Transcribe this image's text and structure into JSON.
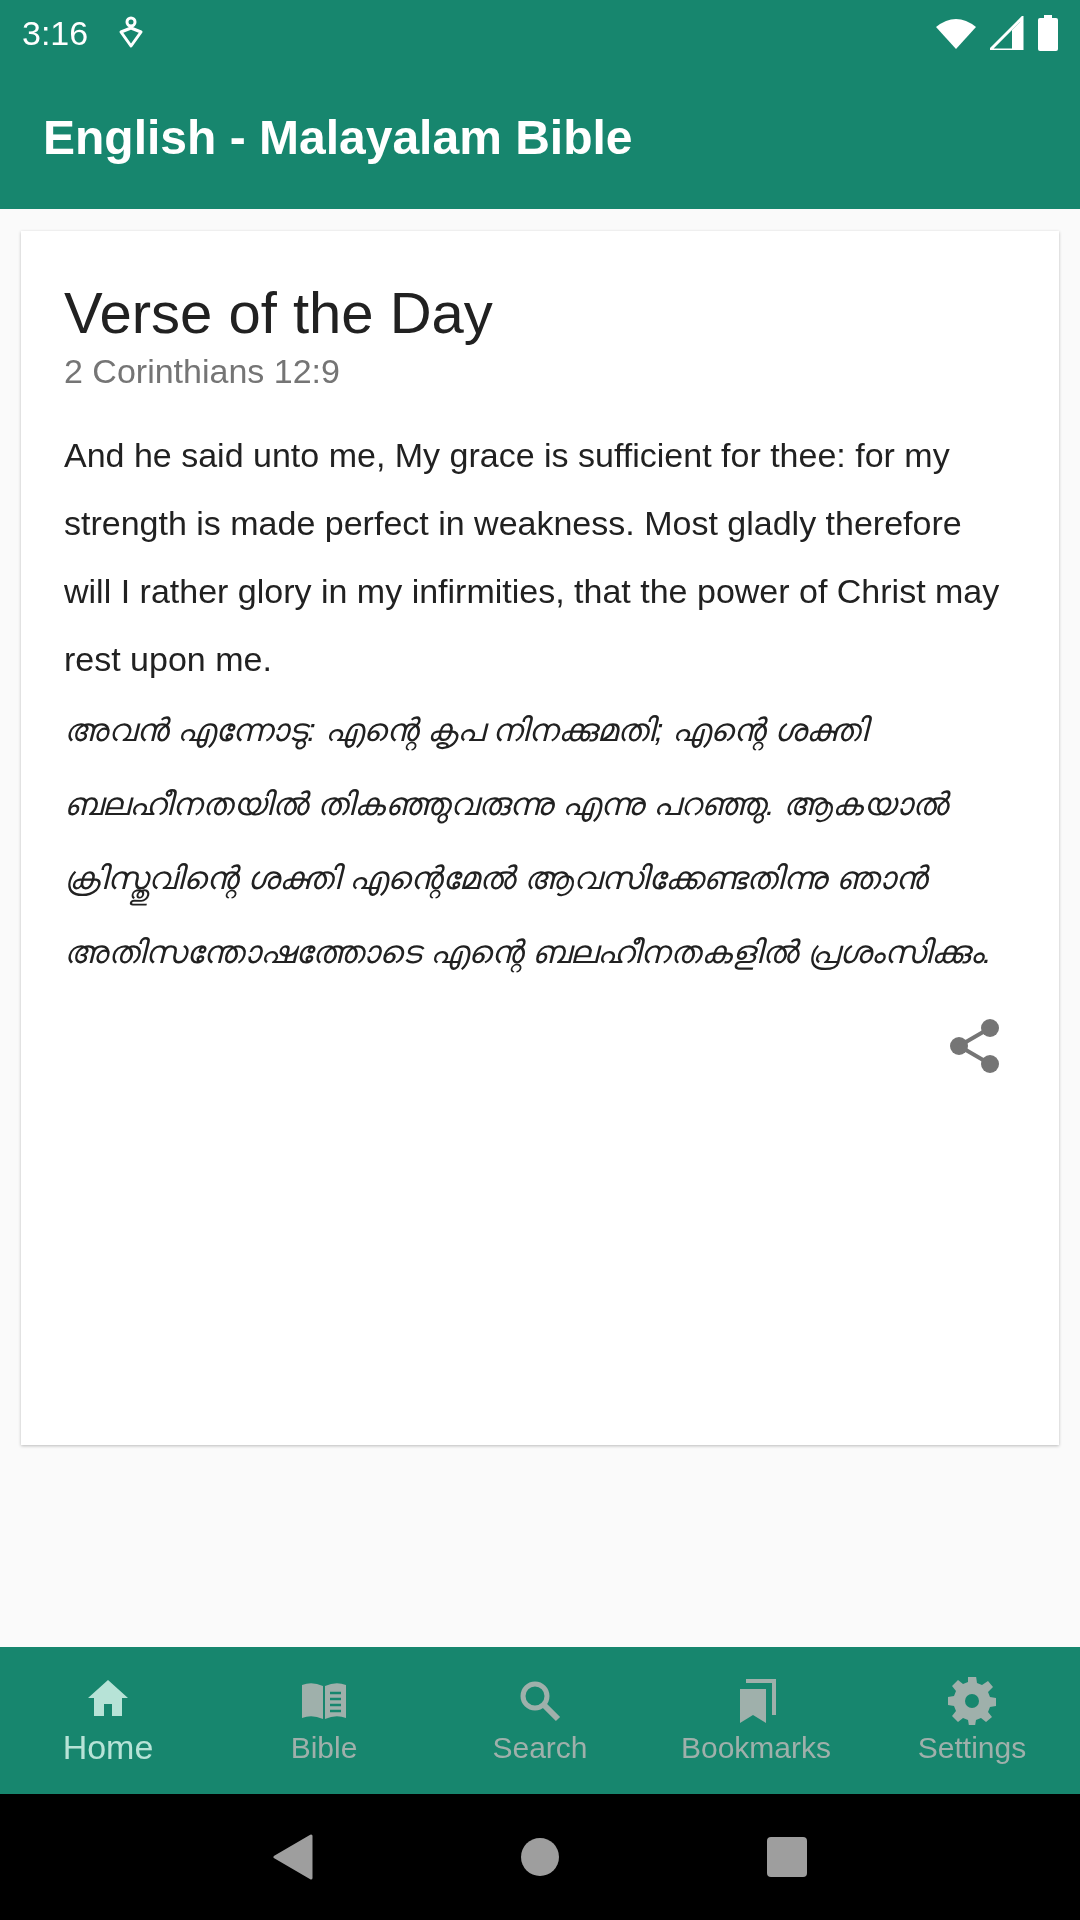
{
  "status_bar": {
    "time": "3:16"
  },
  "app_bar": {
    "title": "English - Malayalam Bible"
  },
  "verse_card": {
    "heading": "Verse of the Day",
    "reference": "2 Corinthians 12:9",
    "english": "And he said unto me, My grace is sufficient for thee: for my strength is made perfect in weakness. Most gladly therefore will I rather glory in my infirmities, that the power of Christ may rest upon me.",
    "malayalam": "അവൻ എന്നോടു: എന്റെ കൃപ നിനക്കുമതി; എന്റെ ശക്തി ബലഹീനതയിൽ തികഞ്ഞുവരുന്നു എന്നു പറഞ്ഞു. ആകയാൽ ക്രിസ്തുവിന്റെ ശക്തി എന്റെമേൽ ആവസിക്കേണ്ടതിന്നു ഞാൻ അതിസന്തോഷത്തോടെ എന്റെ ബലഹീനതകളിൽ പ്രശംസിക്കും."
  },
  "bottom_nav": [
    {
      "kind": "home",
      "label": "Home",
      "selected": true
    },
    {
      "kind": "bible",
      "label": "Bible",
      "selected": false
    },
    {
      "kind": "search",
      "label": "Search",
      "selected": false
    },
    {
      "kind": "bookmarks",
      "label": "Bookmarks",
      "selected": false
    },
    {
      "kind": "settings",
      "label": "Settings",
      "selected": false
    }
  ]
}
